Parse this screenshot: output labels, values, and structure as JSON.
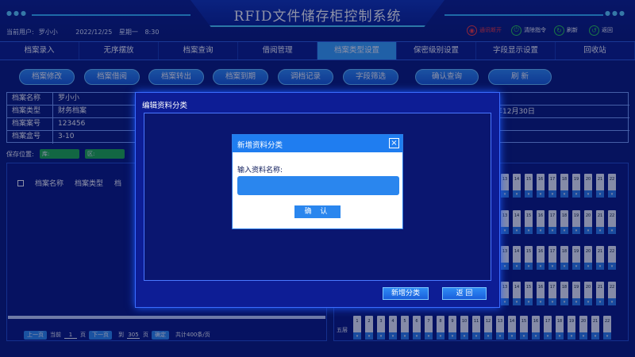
{
  "header": {
    "title": "RFID文件储存柜控制系统",
    "user_label": "当前用户:",
    "user_name": "罗小小",
    "date": "2022/12/25",
    "weekday": "星期一",
    "time": "8:30",
    "buttons": [
      {
        "label": "通讯断开",
        "icon": "signal-off-icon",
        "color": "#ff3b3b"
      },
      {
        "label": "清除指令",
        "icon": "power-icon",
        "color": "#2fd14f"
      },
      {
        "label": "刷新",
        "icon": "refresh-icon",
        "color": "#2fd14f"
      },
      {
        "label": "返回",
        "icon": "back-icon",
        "color": "#2fd14f"
      }
    ]
  },
  "nav": {
    "tabs": [
      "档案录入",
      "无序摆放",
      "档案查询",
      "借阅管理",
      "档案类型设置",
      "保密级别设置",
      "字段显示设置",
      "回收站"
    ],
    "active": "档案类型设置"
  },
  "actions": [
    "档案修改",
    "档案借阅",
    "档案转出",
    "档案到期",
    "调档记录",
    "字段筛选",
    "确认查询",
    "刷 新"
  ],
  "info": {
    "rows": [
      {
        "key": "档案名称",
        "value": "罗小小"
      },
      {
        "key": "档案类型",
        "value": "财务档案"
      },
      {
        "key": "档案案号",
        "value": "123456"
      },
      {
        "key": "档案盒号",
        "value": "3-10"
      }
    ],
    "date_fragment": "年12月30日"
  },
  "save_location": {
    "label": "保存位置:",
    "fields": [
      "库:",
      "区:"
    ]
  },
  "list": {
    "columns": [
      "档案名称",
      "档案类型",
      "档"
    ]
  },
  "pager": {
    "prev": "上一页",
    "current_label": "当前",
    "current": "1",
    "page_unit": "页",
    "next": "下一页",
    "goto_label": "到",
    "goto_value": "305",
    "goto_unit": "页",
    "confirm": "确定",
    "total": "共计400条/页"
  },
  "cabinet": {
    "shelf_label": "五层",
    "row_numbers": [
      [
        "13",
        "14",
        "15",
        "16",
        "17",
        "18",
        "19",
        "20",
        "21",
        "22"
      ],
      [
        "13",
        "14",
        "15",
        "16",
        "17",
        "18",
        "19",
        "20",
        "21",
        "22"
      ],
      [
        "13",
        "14",
        "15",
        "16",
        "17",
        "18",
        "19",
        "20",
        "21",
        "22"
      ],
      [
        "13",
        "14",
        "15",
        "16",
        "17",
        "18",
        "19",
        "20",
        "21",
        "22"
      ],
      [
        "1",
        "2",
        "3",
        "4",
        "5",
        "6",
        "7",
        "8",
        "9",
        "10",
        "11",
        "12",
        "13",
        "14",
        "15",
        "16",
        "17",
        "18",
        "19",
        "20",
        "21",
        "22"
      ]
    ]
  },
  "edit_dialog": {
    "title": "编辑资料分类",
    "add_button": "新增分类",
    "back_button": "返 回"
  },
  "new_dialog": {
    "title": "新增资料分类",
    "close": "×",
    "field_label": "输入资料名称:",
    "input_value": "",
    "confirm": "确 认"
  }
}
